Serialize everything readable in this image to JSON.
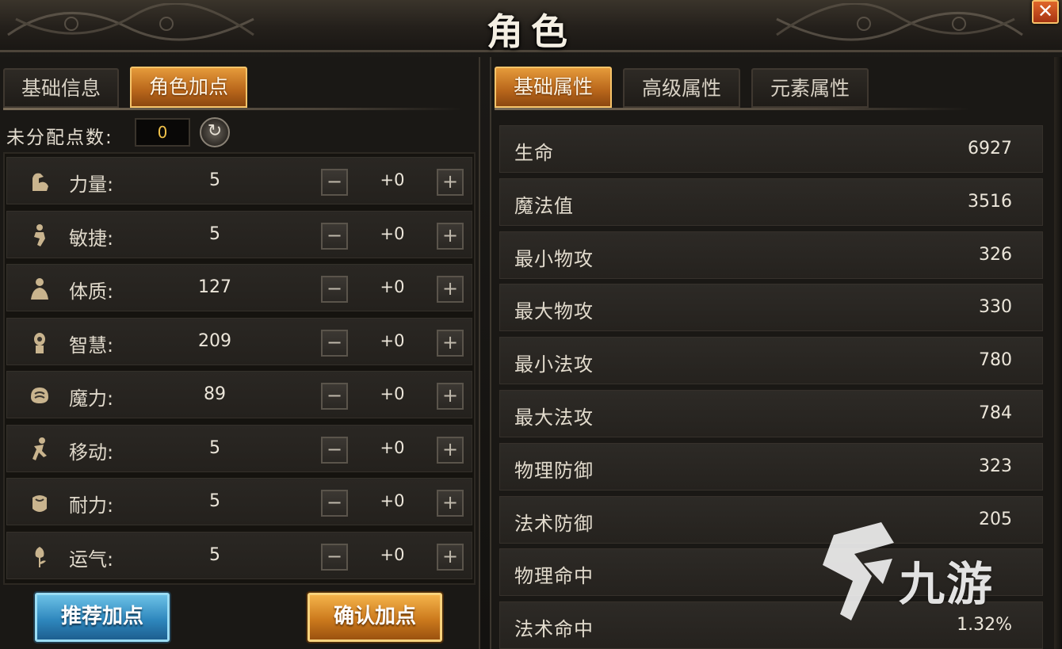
{
  "window": {
    "title": "角色",
    "close_label": "✕"
  },
  "left_tabs": [
    {
      "label": "基础信息",
      "active": false
    },
    {
      "label": "角色加点",
      "active": true
    }
  ],
  "right_tabs": [
    {
      "label": "基础属性",
      "active": true
    },
    {
      "label": "高级属性",
      "active": false
    },
    {
      "label": "元素属性",
      "active": false
    }
  ],
  "unassigned": {
    "label": "未分配点数:",
    "value": "0"
  },
  "stats": [
    {
      "name": "力量:",
      "value": "5",
      "added": "+0",
      "icon": "arm-icon"
    },
    {
      "name": "敏捷:",
      "value": "5",
      "added": "+0",
      "icon": "agility-icon"
    },
    {
      "name": "体质:",
      "value": "127",
      "added": "+0",
      "icon": "body-icon"
    },
    {
      "name": "智慧:",
      "value": "209",
      "added": "+0",
      "icon": "wisdom-icon"
    },
    {
      "name": "魔力:",
      "value": "89",
      "added": "+0",
      "icon": "magic-icon"
    },
    {
      "name": "移动:",
      "value": "5",
      "added": "+0",
      "icon": "move-icon"
    },
    {
      "name": "耐力:",
      "value": "5",
      "added": "+0",
      "icon": "stamina-icon"
    },
    {
      "name": "运气:",
      "value": "5",
      "added": "+0",
      "icon": "luck-icon"
    }
  ],
  "stat_buttons": {
    "minus": "−",
    "plus": "+"
  },
  "buttons": {
    "recommend": "推荐加点",
    "confirm": "确认加点"
  },
  "attributes": [
    {
      "name": "生命",
      "value": "6927"
    },
    {
      "name": "魔法值",
      "value": "3516"
    },
    {
      "name": "最小物攻",
      "value": "326"
    },
    {
      "name": "最大物攻",
      "value": "330"
    },
    {
      "name": "最小法攻",
      "value": "780"
    },
    {
      "name": "最大法攻",
      "value": "784"
    },
    {
      "name": "物理防御",
      "value": "323"
    },
    {
      "name": "法术防御",
      "value": "205"
    },
    {
      "name": "物理命中",
      "value": ""
    },
    {
      "name": "法术命中",
      "value": "1.32%"
    }
  ],
  "watermark": {
    "text": "九游"
  },
  "colors": {
    "accent_orange": "#e59a3a",
    "accent_blue": "#2f88be",
    "points_yellow": "#f1c24a",
    "close_red": "#a63412"
  }
}
